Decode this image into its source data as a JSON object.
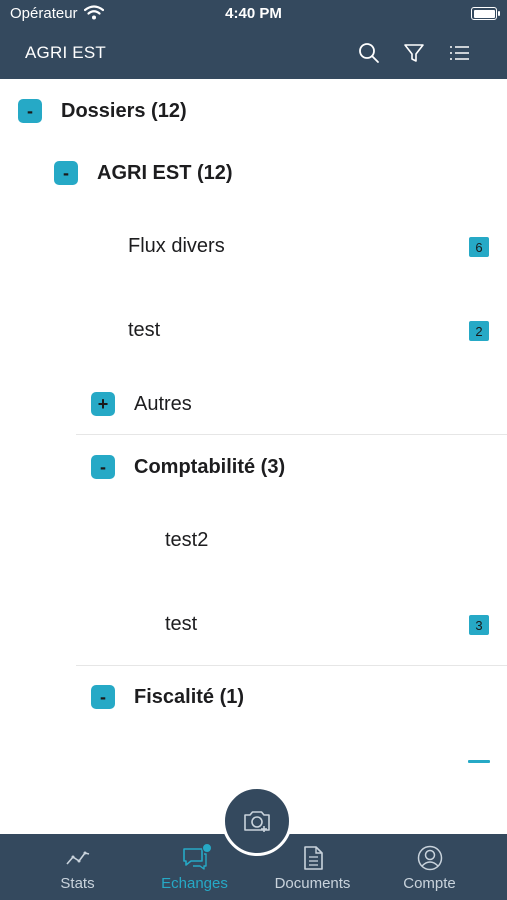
{
  "status_bar": {
    "carrier": "Opérateur",
    "time": "4:40 PM"
  },
  "header": {
    "title": "AGRI EST",
    "icons": [
      "search-icon",
      "filter-icon",
      "list-icon"
    ]
  },
  "tree": {
    "root": {
      "label": "Dossiers (12)",
      "toggle": "-"
    },
    "company": {
      "label": "AGRI EST (12)",
      "toggle": "-"
    },
    "company_items": [
      {
        "label": "Flux divers",
        "count": "6"
      },
      {
        "label": "test",
        "count": "2"
      }
    ],
    "autres": {
      "label": "Autres",
      "toggle": "+"
    },
    "comptabilite": {
      "label": "Comptabilité (3)",
      "toggle": "-"
    },
    "comptabilite_items": [
      {
        "label": "test2",
        "count": ""
      },
      {
        "label": "test",
        "count": "3"
      }
    ],
    "fiscalite": {
      "label": "Fiscalité (1)",
      "toggle": "-"
    }
  },
  "tabbar": {
    "tabs": [
      {
        "label": "Stats",
        "icon": "stats-icon",
        "active": false
      },
      {
        "label": "Echanges",
        "icon": "chat-icon",
        "active": true
      },
      {
        "label": "Documents",
        "icon": "document-icon",
        "active": false
      },
      {
        "label": "Compte",
        "icon": "account-icon",
        "active": false
      }
    ],
    "fab_icon": "camera-add-icon"
  },
  "colors": {
    "header_bg": "#34495e",
    "accent": "#26a9c6",
    "background": "#ffffff"
  }
}
